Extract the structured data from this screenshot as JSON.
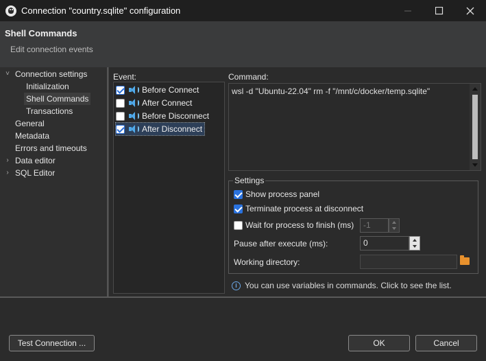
{
  "window": {
    "title": "Connection \"country.sqlite\" configuration"
  },
  "header": {
    "title": "Shell Commands",
    "subtitle": "Edit connection events"
  },
  "tree": {
    "items": [
      {
        "label": "Connection settings",
        "expanded": true
      },
      {
        "label": "Initialization"
      },
      {
        "label": "Shell Commands",
        "selected": true
      },
      {
        "label": "Transactions"
      },
      {
        "label": "General"
      },
      {
        "label": "Metadata"
      },
      {
        "label": "Errors and timeouts"
      },
      {
        "label": "Data editor",
        "expandable": true
      },
      {
        "label": "SQL Editor",
        "expandable": true
      }
    ]
  },
  "events": {
    "label": "Event:",
    "items": [
      {
        "label": "Before Connect",
        "checked": true
      },
      {
        "label": "After Connect",
        "checked": false
      },
      {
        "label": "Before Disconnect",
        "checked": false
      },
      {
        "label": "After Disconnect",
        "checked": true,
        "selected": true
      }
    ]
  },
  "command": {
    "label": "Command:",
    "value": "wsl -d \"Ubuntu-22.04\" rm -f \"/mnt/c/docker/temp.sqlite\""
  },
  "settings": {
    "legend": "Settings",
    "show_process_panel": {
      "label": "Show process panel",
      "checked": true
    },
    "terminate_on_disconnect": {
      "label": "Terminate process at disconnect",
      "checked": true
    },
    "wait_for_finish": {
      "label": "Wait for process to finish (ms)",
      "checked": false,
      "value": "-1"
    },
    "pause_after_execute": {
      "label": "Pause after execute (ms):",
      "value": "0"
    },
    "working_directory": {
      "label": "Working directory:",
      "value": ""
    }
  },
  "info": {
    "text": "You can use variables in commands. Click to see the list."
  },
  "buttons": {
    "test_connection": "Test Connection ...",
    "ok": "OK",
    "cancel": "Cancel"
  },
  "colors": {
    "accent": "#2a72de",
    "folder": "#e8912d",
    "speaker": "#4fa8e8"
  }
}
